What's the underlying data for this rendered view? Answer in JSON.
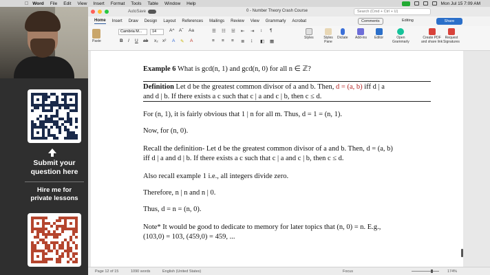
{
  "menubar": {
    "app": "Word",
    "items": [
      "File",
      "Edit",
      "View",
      "Insert",
      "Format",
      "Tools",
      "Table",
      "Window",
      "Help"
    ],
    "datetime": "Mon Jul 15  7:09 AM"
  },
  "side_panel": {
    "promo1_line1": "Submit your",
    "promo1_line2": "question here",
    "promo2_line1": "Hire me for",
    "promo2_line2": "private lessons"
  },
  "titlebar": {
    "autosave": "AutoSave",
    "doc_title": "0 - Number Theory Crash Course",
    "search_placeholder": "Search (Cmd + Ctrl + U)"
  },
  "tabs": [
    "Home",
    "Insert",
    "Draw",
    "Design",
    "Layout",
    "References",
    "Mailings",
    "Review",
    "View",
    "Grammarly",
    "Acrobat"
  ],
  "tab_actions": {
    "comments": "Comments",
    "editing": "Editing",
    "share": "Share"
  },
  "ribbon": {
    "paste": "Paste",
    "font_name": "Cambria M...",
    "font_size": "14",
    "styles": "Styles",
    "styles_pane": "Styles Pane",
    "dictate": "Dictate",
    "addins": "Add-ins",
    "editor": "Editor",
    "open_grammarly_1": "Open",
    "open_grammarly_2": "Grammarly",
    "create_pdf_1": "Create PDF",
    "create_pdf_2": "and share link",
    "request_sig_1": "Request",
    "request_sig_2": "Signatures"
  },
  "document": {
    "example_label": "Example 6",
    "example_text": "What is gcd(n, 1) and gcd(n, 0) for all n ∈ ℤ?",
    "def_label": "Definition",
    "def_text_a": "Let d be the greatest common divisor of a and b. Then,",
    "def_red": "d = (a, b)",
    "def_text_b": "iff d | a",
    "def_line2": "and d | b. If there exists a c such that c | a and c | b, then c ≤ d.",
    "para1": "For (n, 1), it is fairly obvious that 1 | n for all m. Thus, d = 1 = (n, 1).",
    "para2": "Now, for (n, 0).",
    "para3_line1": "Recall the definition- Let d be the greatest common divisor of a and b. Then, d = (a, b)",
    "para3_line2": "iff d | a and d | b. If there exists a c such that c | a and c | b, then c ≤ d.",
    "para4": "Also recall example 1 i.e., all integers divide zero.",
    "para5": "Therefore, n | n and n | 0.",
    "para6": "Thus, d = n = (n, 0).",
    "para7_line1": "Note* It would be good to dedicate to memory for later topics that (n, 0) = n. E.g.,",
    "para7_line2": "(103,0) = 103, (459,0) = 459, ..."
  },
  "statusbar": {
    "page": "Page 12 of 15",
    "words": "1090 words",
    "language": "English (United States)",
    "focus": "Focus",
    "zoom": "174%"
  },
  "colors": {
    "accent": "#2b6fc9",
    "definition_red": "#b22222",
    "side_panel": "#2f2f2f"
  }
}
